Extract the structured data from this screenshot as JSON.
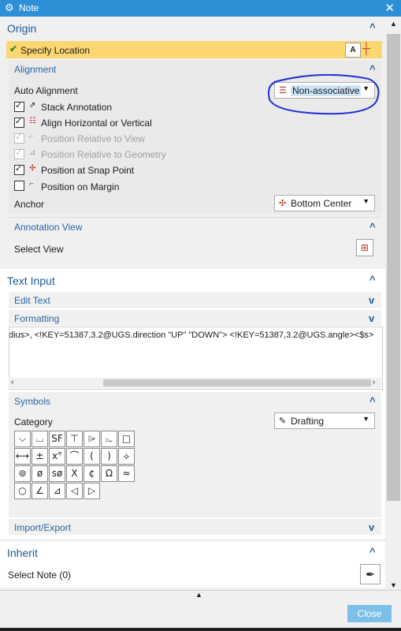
{
  "window": {
    "title": "Note"
  },
  "origin": {
    "title": "Origin",
    "specify_location": "Specify Location",
    "alignment": {
      "title": "Alignment",
      "auto_alignment_label": "Auto Alignment",
      "auto_alignment_value": "Non-associative",
      "options": [
        {
          "label": "Stack Annotation",
          "checked": true,
          "enabled": true
        },
        {
          "label": "Align Horizontal or Vertical",
          "checked": true,
          "enabled": true
        },
        {
          "label": "Position Relative to View",
          "checked": true,
          "enabled": false
        },
        {
          "label": "Position Relative to Geometry",
          "checked": true,
          "enabled": false
        },
        {
          "label": "Position at Snap Point",
          "checked": true,
          "enabled": true
        },
        {
          "label": "Position on Margin",
          "checked": false,
          "enabled": true
        }
      ],
      "anchor_label": "Anchor",
      "anchor_value": "Bottom Center"
    },
    "annotation_view": {
      "title": "Annotation View",
      "select_view": "Select View"
    }
  },
  "text_input": {
    "title": "Text Input",
    "edit_text": "Edit Text",
    "formatting": "Formatting",
    "text_content": "dius>, <!KEY=51387,3.2@UGS.direction \"UP\" \"DOWN\"> <!KEY=51387,3.2@UGS.angle><$s>",
    "symbols": {
      "title": "Symbols",
      "category_label": "Category",
      "category_value": "Drafting",
      "grid": [
        [
          "⌵",
          "⌴",
          "SF",
          "⊤",
          "⌲",
          "⌳",
          "□"
        ],
        [
          "⟷",
          "±",
          "x°",
          "⌒",
          "(",
          ")",
          "⟡"
        ],
        [
          "⊚",
          "ø",
          "sø",
          "X",
          "¢",
          "Ω",
          "≈"
        ],
        [
          "○",
          "∠",
          "⊿",
          "◁",
          "▷"
        ]
      ]
    },
    "import_export": "Import/Export"
  },
  "inherit": {
    "title": "Inherit",
    "select_note": "Select Note (0)"
  },
  "footer": {
    "close": "Close"
  }
}
